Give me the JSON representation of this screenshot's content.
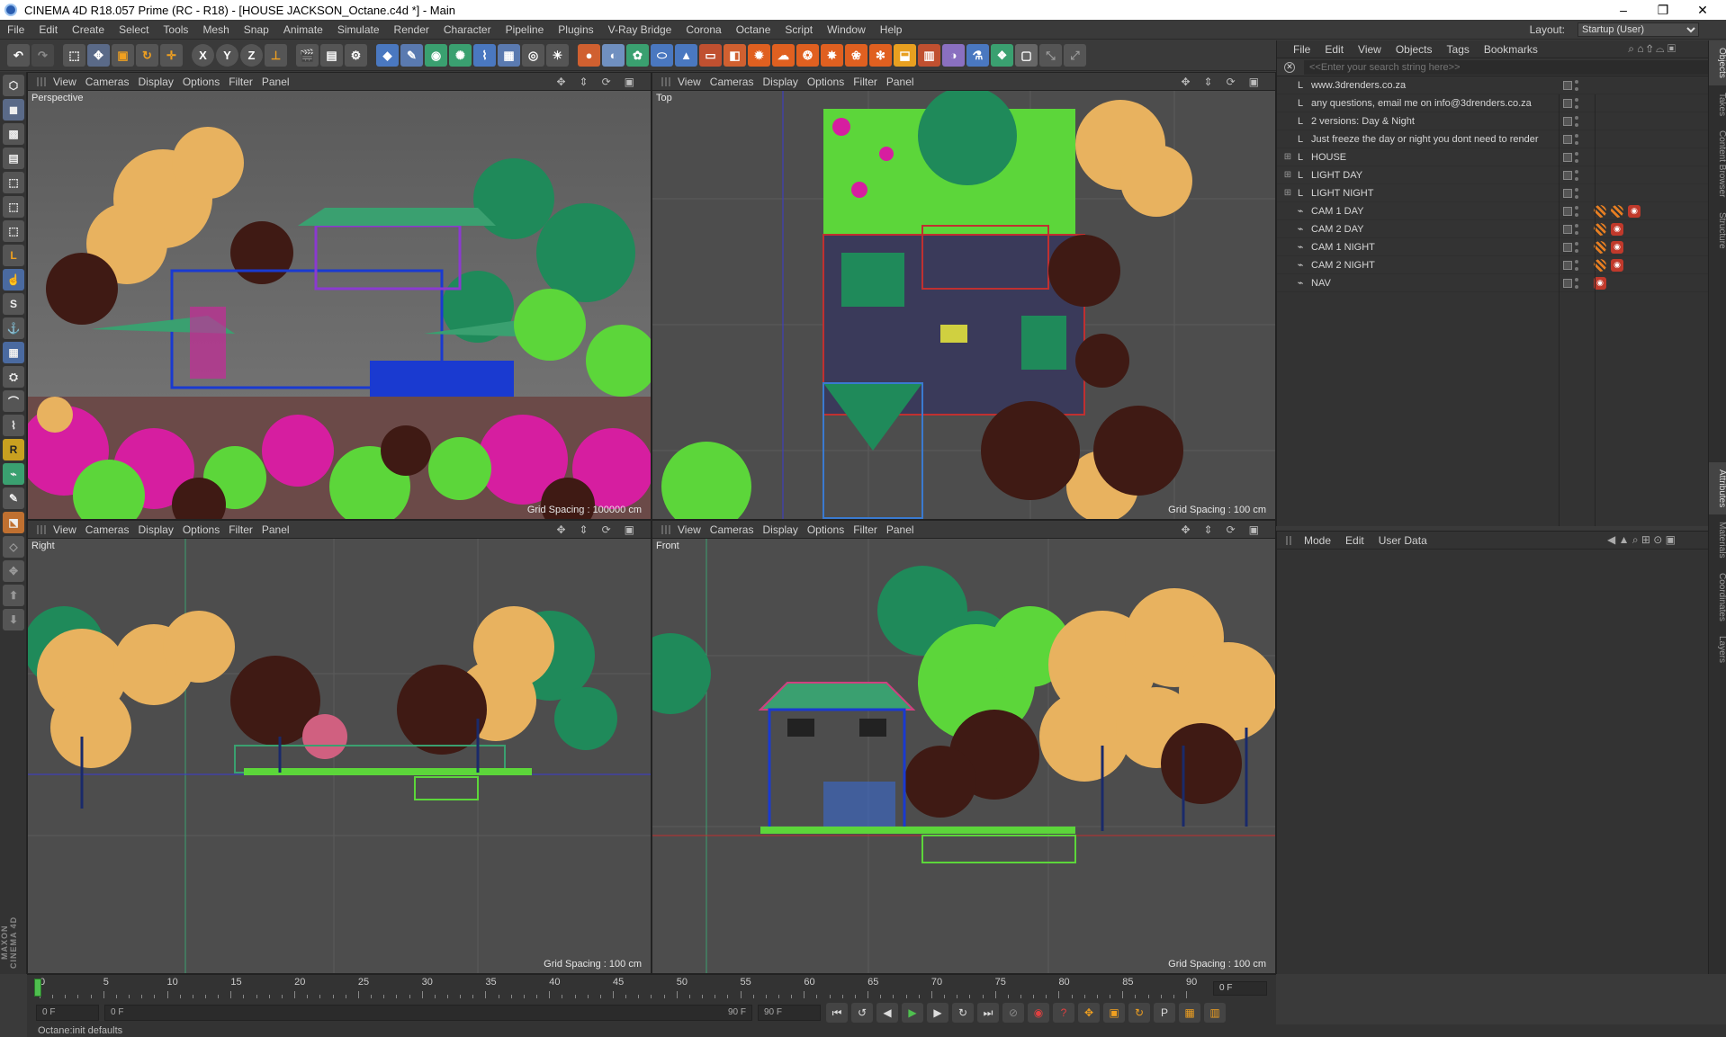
{
  "window": {
    "title": "CINEMA 4D R18.057 Prime (RC - R18) - [HOUSE JACKSON_Octane.c4d *] - Main",
    "minimize": "–",
    "restore": "❐",
    "close": "✕"
  },
  "menubar": {
    "items": [
      "File",
      "Edit",
      "Create",
      "Select",
      "Tools",
      "Mesh",
      "Snap",
      "Animate",
      "Simulate",
      "Render",
      "Character",
      "Pipeline",
      "Plugins",
      "V-Ray Bridge",
      "Corona",
      "Octane",
      "Script",
      "Window",
      "Help"
    ],
    "layout_label": "Layout:",
    "layout_value": "Startup (User)"
  },
  "toolbar": {
    "axis_x": "X",
    "axis_y": "Y",
    "axis_z": "Z"
  },
  "viewport_menu": [
    "View",
    "Cameras",
    "Display",
    "Options",
    "Filter",
    "Panel"
  ],
  "viewports": [
    {
      "name": "Perspective",
      "grid": "Grid Spacing : 100000 cm"
    },
    {
      "name": "Top",
      "grid": "Grid Spacing : 100 cm"
    },
    {
      "name": "Right",
      "grid": "Grid Spacing : 100 cm"
    },
    {
      "name": "Front",
      "grid": "Grid Spacing : 100 cm"
    }
  ],
  "object_manager": {
    "menu": [
      "File",
      "Edit",
      "View",
      "Objects",
      "Tags",
      "Bookmarks"
    ],
    "search_placeholder": "<<Enter your search string here>>",
    "objects": [
      {
        "label": "www.3drenders.co.za",
        "icon": "layer-icon",
        "expandable": false,
        "tags": 0
      },
      {
        "label": "any questions, email me on info@3drenders.co.za",
        "icon": "layer-icon",
        "expandable": false,
        "tags": 0
      },
      {
        "label": "2 versions: Day & Night",
        "icon": "layer-icon",
        "expandable": false,
        "tags": 0
      },
      {
        "label": "Just freeze the day or night you dont need to render",
        "icon": "layer-icon",
        "expandable": false,
        "tags": 0
      },
      {
        "label": "HOUSE",
        "icon": "null-icon",
        "expandable": true,
        "tags": 0
      },
      {
        "label": "LIGHT DAY",
        "icon": "null-icon",
        "expandable": true,
        "tags": 0
      },
      {
        "label": "LIGHT NIGHT",
        "icon": "null-icon",
        "expandable": true,
        "tags": 0
      },
      {
        "label": "CAM 1 DAY",
        "icon": "camera-icon",
        "expandable": false,
        "tags": 3
      },
      {
        "label": "CAM 2 DAY",
        "icon": "camera-icon",
        "expandable": false,
        "tags": 2
      },
      {
        "label": "CAM 1 NIGHT",
        "icon": "camera-icon",
        "expandable": false,
        "tags": 2
      },
      {
        "label": "CAM 2 NIGHT",
        "icon": "camera-icon",
        "expandable": false,
        "tags": 2
      },
      {
        "label": "NAV",
        "icon": "camera-icon",
        "expandable": false,
        "tags": 1
      }
    ]
  },
  "attributes": {
    "menu": [
      "Mode",
      "Edit",
      "User Data"
    ]
  },
  "side_tabs_top": [
    "Objects",
    "Takes",
    "Content Browser",
    "Structure"
  ],
  "side_tabs_bottom": [
    "Attributes",
    "Materials",
    "Coordinates",
    "Layers"
  ],
  "timeline": {
    "ticks": [
      "0",
      "5",
      "10",
      "15",
      "20",
      "25",
      "30",
      "35",
      "40",
      "45",
      "50",
      "55",
      "60",
      "65",
      "70",
      "75",
      "80",
      "85",
      "90"
    ],
    "current_frame": "0 F"
  },
  "transport": {
    "start": "0 F",
    "range_start": "0 F",
    "range_end": "90 F",
    "end": "90 F"
  },
  "status": "Octane:init defaults",
  "brand": "MAXON CINEMA 4D",
  "colors": {
    "foliage_tan": "#e8b25f",
    "foliage_green": "#5cd63a",
    "foliage_dark": "#3f1a14",
    "foliage_magenta": "#d61ea0",
    "foliage_teal": "#1f8a5a",
    "house_blue": "#1a3ad0"
  }
}
